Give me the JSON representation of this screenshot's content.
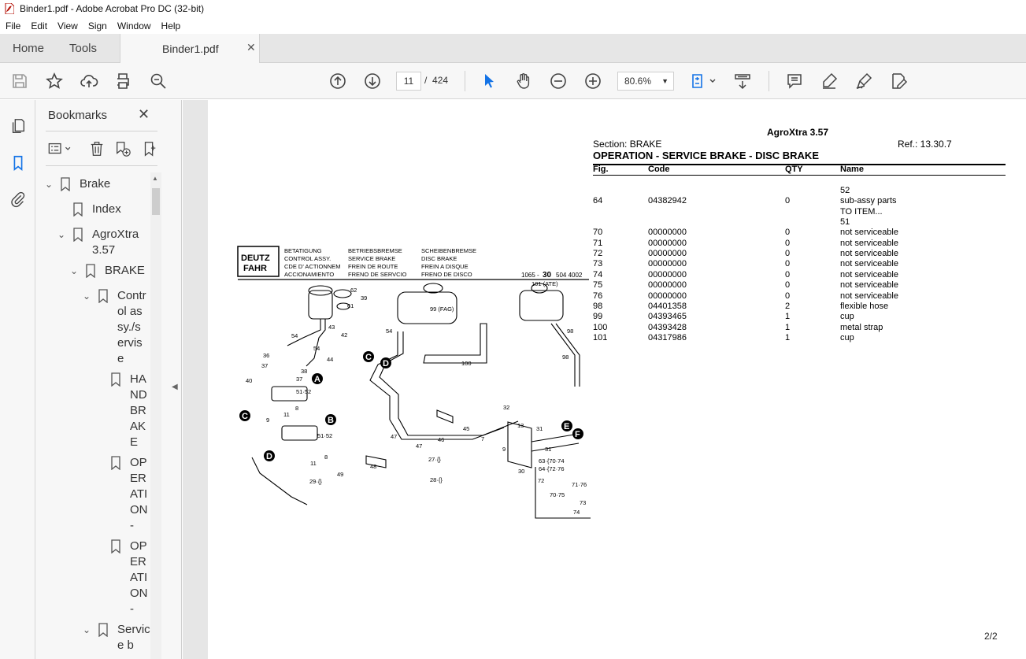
{
  "window": {
    "title": "Binder1.pdf - Adobe Acrobat Pro DC (32-bit)"
  },
  "menu": [
    "File",
    "Edit",
    "View",
    "Sign",
    "Window",
    "Help"
  ],
  "tabs": {
    "home": "Home",
    "tools": "Tools",
    "document": "Binder1.pdf"
  },
  "toolbar": {
    "page_current": "11",
    "page_sep": "/",
    "page_total": "424",
    "zoom": "80.6%"
  },
  "bookmarks": {
    "header": "Bookmarks",
    "items": [
      {
        "label": "Brake"
      },
      {
        "label": "Index"
      },
      {
        "label": "AgroXtra 3.57"
      },
      {
        "label": "BRAKE"
      },
      {
        "label": "Control assy./servise"
      },
      {
        "label": "HANDBRAKE"
      },
      {
        "label": "OPERATION -"
      },
      {
        "label": "OPERATION -"
      },
      {
        "label": "Service b"
      }
    ]
  },
  "pdf": {
    "model": "AgroXtra 3.57",
    "section": "Section: BRAKE",
    "ref": "Ref.: 13.30.7",
    "heading": "OPERATION - SERVICE BRAKE - DISC BRAKE",
    "columns": {
      "fig": "Fig.",
      "code": "Code",
      "qty": "QTY",
      "name": "Name"
    },
    "rows": [
      {
        "fig": "",
        "code": "",
        "qty": "",
        "name": "52"
      },
      {
        "fig": "64",
        "code": "04382942",
        "qty": "0",
        "name": "sub-assy parts"
      },
      {
        "fig": "",
        "code": "",
        "qty": "",
        "name": "TO ITEM..."
      },
      {
        "fig": "",
        "code": "",
        "qty": "",
        "name": "51"
      },
      {
        "fig": "70",
        "code": "00000000",
        "qty": "0",
        "name": "not serviceable"
      },
      {
        "fig": "71",
        "code": "00000000",
        "qty": "0",
        "name": "not serviceable"
      },
      {
        "fig": "72",
        "code": "00000000",
        "qty": "0",
        "name": "not serviceable"
      },
      {
        "fig": "73",
        "code": "00000000",
        "qty": "0",
        "name": "not serviceable"
      },
      {
        "fig": "74",
        "code": "00000000",
        "qty": "0",
        "name": "not serviceable"
      },
      {
        "fig": "75",
        "code": "00000000",
        "qty": "0",
        "name": "not serviceable"
      },
      {
        "fig": "76",
        "code": "00000000",
        "qty": "0",
        "name": "not serviceable"
      },
      {
        "fig": "98",
        "code": "04401358",
        "qty": "2",
        "name": "flexible hose"
      },
      {
        "fig": "99",
        "code": "04393465",
        "qty": "1",
        "name": "cup"
      },
      {
        "fig": "100",
        "code": "04393428",
        "qty": "1",
        "name": "metal strap"
      },
      {
        "fig": "101",
        "code": "04317986",
        "qty": "1",
        "name": "cup"
      }
    ],
    "diagram": {
      "brand_1": "DEUTZ",
      "brand_2": "FAHR",
      "hdr_de": "BETATIGUNG",
      "hdr_en": "CONTROL ASSY.",
      "hdr_fr": "CDE D' ACTIONNEM",
      "hdr_es": "ACCIONAMIENTO",
      "sub_de": "BETRIEBSBREMSE",
      "sub_en": "SERVICE  BRAKE",
      "sub_fr": "FREIN DE ROUTE",
      "sub_es": "FRENO DE SERVCIO",
      "d_de": "SCHEIBENBREMSE",
      "d_en": "DISC BRAKE",
      "d_fr": "FREIN A DISQUE",
      "d_es": "FRENO DE DISCO",
      "docnum_a": "1065 -",
      "docnum_b": "30",
      "docnum_c": "504 4002",
      "markers": [
        "A",
        "B",
        "C",
        "D",
        "C",
        "D",
        "E",
        "F"
      ],
      "labels": [
        "62",
        "39",
        "61",
        "42",
        "43",
        "54",
        "54",
        "44",
        "36",
        "37",
        "38",
        "37",
        "40",
        "51·52",
        "8",
        "11",
        "9",
        "51·52",
        "8",
        "11",
        "29·{}",
        "99 (FAG)",
        "54",
        "100",
        "101 (ATE)",
        "98",
        "98",
        "47",
        "47",
        "45",
        "46",
        "48",
        "49",
        "27·{}",
        "28·{}",
        "32",
        "13",
        "31",
        "31",
        "7",
        "9",
        "30",
        "63·{70·74",
        "64·{72·76",
        "72",
        "70·75",
        "71·76",
        "73",
        "74"
      ]
    },
    "page_indicator": "2/2"
  }
}
